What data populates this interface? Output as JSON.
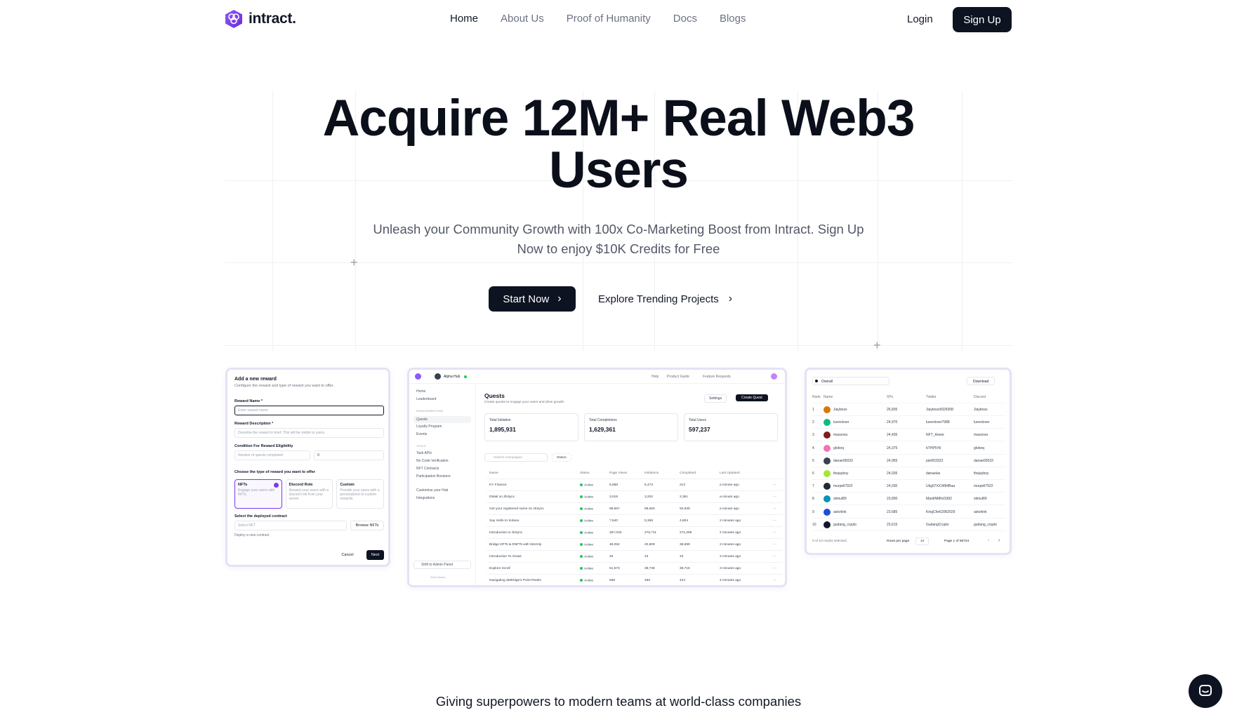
{
  "brand": {
    "name": "intract."
  },
  "nav": {
    "links": [
      "Home",
      "About Us",
      "Proof of Humanity",
      "Docs",
      "Blogs"
    ],
    "login": "Login",
    "signup": "Sign Up"
  },
  "hero": {
    "title_line1": "Acquire 12M+ Real Web3",
    "title_line2": "Users",
    "subtitle_line1": "Unleash your Community Growth with 100x Co-Marketing Boost from Intract. Sign Up",
    "subtitle_line2": "Now to enjoy $10K Credits for Free",
    "start": "Start Now",
    "explore": "Explore Trending Projects"
  },
  "reward_card": {
    "title": "Add a new reward",
    "desc": "Configure the reward and type of reward you want to offer.",
    "name_label": "Reward Name *",
    "name_placeholder": "Enter reward name",
    "desc_label": "Reward Description *",
    "desc_placeholder": "Describe the reward in brief. This will be visible to users.",
    "cond_label": "Condition For Reward Eligibility",
    "cond_select": "Number of quests completed",
    "cond_value": "0",
    "type_label": "Choose the type of reward you want to offer",
    "options": [
      {
        "title": "NFTs",
        "desc": "Engage your users with NFTs."
      },
      {
        "title": "Discord Role",
        "desc": "Reward your users with a discord role from your server."
      },
      {
        "title": "Custom",
        "desc": "Provide your users with a personalized or custom rewards."
      }
    ],
    "contract_label": "Select the deployed contract",
    "contract_select": "Select NFT",
    "browse": "Browse NFTs",
    "deploy_new": "Deploy a new contract",
    "cancel": "Cancel",
    "next": "Next"
  },
  "dashboard_card": {
    "hub": "Alpha Hub",
    "top_links": [
      "Help",
      "Product Guide",
      "Feature Requests"
    ],
    "sidebar": {
      "top": [
        "Home",
        "Leaderboard"
      ],
      "section1": "ENGAGEMENT HUB",
      "engage": [
        "Quests",
        "Loyalty Program",
        "Events"
      ],
      "section2": "TOOLS",
      "tools": [
        "Task APIs",
        "No Code Verification",
        "NFT Contracts",
        "Participation Boosters"
      ],
      "bottom": [
        "Customise your Hub",
        "Integrations"
      ],
      "admin": "Shift to Admin Panel",
      "copyright": "2024 Intract"
    },
    "heading": "Quests",
    "subheading": "Create quests to engage your users and drive growth.",
    "settings": "Settings",
    "create": "Create Quest",
    "stats": [
      {
        "label": "Total Initiation",
        "value": "1,895,931"
      },
      {
        "label": "Total Completions",
        "value": "1,629,361"
      },
      {
        "label": "Total Users",
        "value": "597,237"
      }
    ],
    "search_placeholder": "Search Campaigns",
    "status_filter": "Status",
    "columns": [
      "Name",
      "Status",
      "Page Views",
      "Initiations",
      "Completed",
      "Last Updated"
    ],
    "rows": [
      [
        "KY Finance",
        "Active",
        "5,988",
        "5,473",
        "213",
        "a minute ago"
      ],
      [
        "DMail on ZkSync",
        "Active",
        "3,519",
        "3,202",
        "2,361",
        "a minute ago"
      ],
      [
        "Get your registered name on zkSync",
        "Active",
        "98,867",
        "96,663",
        "92,939",
        "a minute ago"
      ],
      [
        "Say Hello to Solana",
        "Active",
        "7,540",
        "5,369",
        "4,804",
        "2 minutes ago"
      ],
      [
        "Introduction to zkSync",
        "Active",
        "287,033",
        "276,711",
        "272,269",
        "2 minutes ago"
      ],
      [
        "Bridge DFTs & DNFTs with Wormly",
        "Active",
        "48,052",
        "40,809",
        "36,699",
        "2 minutes ago"
      ],
      [
        "Introduction To Graas",
        "Active",
        "45",
        "43",
        "43",
        "3 minutes ago"
      ],
      [
        "Explore Scroll",
        "Active",
        "61,573",
        "38,736",
        "38,715",
        "3 minutes ago"
      ],
      [
        "Navigating deBridge's Point Realm",
        "Active",
        "558",
        "460",
        "424",
        "4 minutes ago"
      ]
    ]
  },
  "leaderboard_card": {
    "filter": "Overall",
    "download": "Download",
    "columns": [
      "Rank",
      "Name",
      "XPs",
      "Twitter",
      "Discord"
    ],
    "rows": [
      [
        "1",
        "Jiayboss",
        "26,835",
        "Jiayboss5926008",
        "Jiayboss"
      ],
      [
        "2",
        "luvexlover",
        "24,970",
        "luvexlover7988",
        "luvexlover"
      ],
      [
        "3",
        "massova",
        "24,435",
        "NFT_Areee",
        "massova"
      ],
      [
        "4",
        "globoq",
        "24,375",
        "bTHPIVN",
        "globoq"
      ],
      [
        "5",
        "danae00033",
        "24,065",
        "pixi003323",
        "danae00033"
      ],
      [
        "6",
        "thejayboy",
        "24,035",
        "danaelas",
        "thejayboy"
      ],
      [
        "7",
        "murpell7922",
        "24,030",
        "Ukg07XX3484Baa",
        "murpell7922"
      ],
      [
        "8",
        "stimul89",
        "23,800",
        "MardiNMhd1992",
        "stimul89"
      ],
      [
        "9",
        "astorlink",
        "23,685",
        "KingChe62062029",
        "astorlink"
      ],
      [
        "10",
        "gudang_crypto",
        "23,615",
        "GudangCrypto",
        "gudang_crypto"
      ]
    ],
    "selected": "0 of 10 row(s) selected.",
    "rows_per_page_label": "Rows per page",
    "rows_per_page": "10",
    "page": "Page 1 of 59724"
  },
  "logos_heading": "Giving superpowers to modern teams at world-class companies",
  "colors": {
    "primary": "#0d1321",
    "accent": "#7c3aed",
    "card_border": "#e6e2f5"
  }
}
